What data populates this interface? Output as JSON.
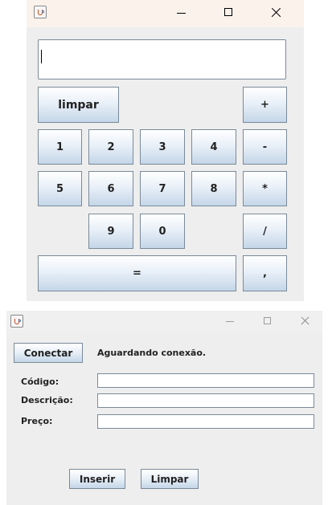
{
  "calculator": {
    "display_value": "",
    "buttons": {
      "clear": "limpar",
      "plus": "+",
      "minus": "-",
      "multiply": "*",
      "divide": "/",
      "equals": "=",
      "comma": ",",
      "digit_1": "1",
      "digit_2": "2",
      "digit_3": "3",
      "digit_4": "4",
      "digit_5": "5",
      "digit_6": "6",
      "digit_7": "7",
      "digit_8": "8",
      "digit_9": "9",
      "digit_0": "0"
    },
    "colors": {
      "titlebar": "#fbf2ec",
      "window_bg": "#eeeeee",
      "button_border": "#7a8a99"
    }
  },
  "form": {
    "connect_label": "Conectar",
    "status_text": "Aguardando conexão.",
    "fields": {
      "code_label": "Código:",
      "code_value": "",
      "description_label": "Descrição:",
      "description_value": "",
      "price_label": "Preço:",
      "price_value": ""
    },
    "insert_label": "Inserir",
    "clear_label": "Limpar",
    "colors": {
      "titlebar": "#f0f0f0",
      "window_bg": "#eeeeee"
    }
  }
}
